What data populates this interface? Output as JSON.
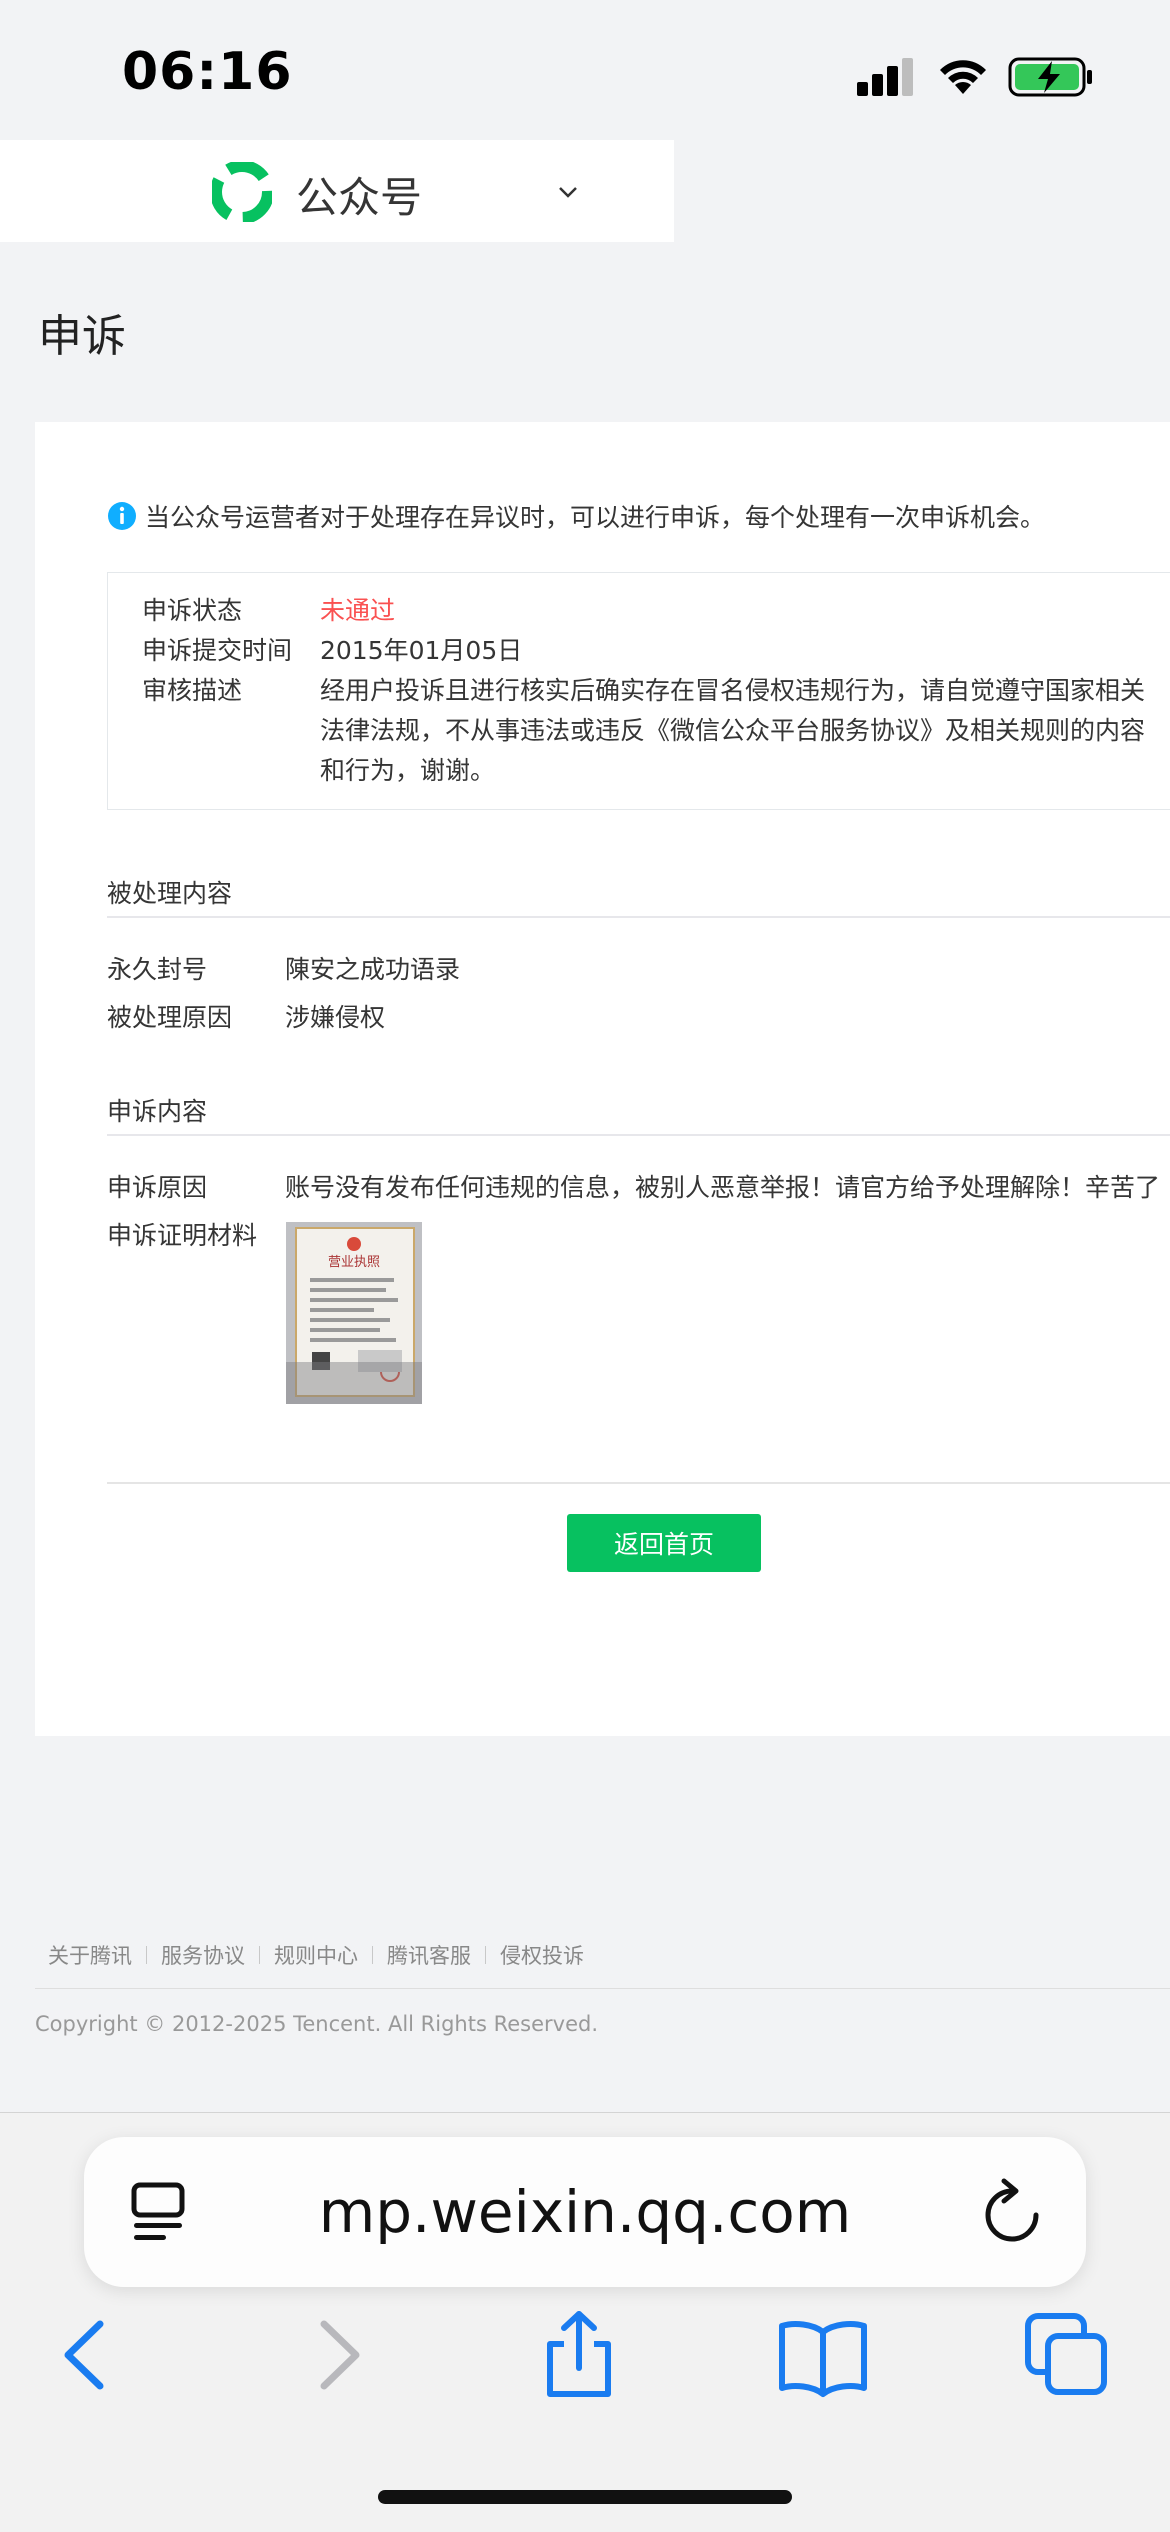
{
  "status_bar": {
    "time": "06:16"
  },
  "header": {
    "brand": "公众号"
  },
  "page": {
    "title": "申诉"
  },
  "notice": {
    "text": "当公众号运营者对于处理存在异议时，可以进行申诉，每个处理有一次申诉机会。"
  },
  "appeal_status": {
    "status_label": "申诉状态",
    "status_value": "未通过",
    "status_color": "#fa5151",
    "submit_label": "申诉提交时间",
    "submit_value": "2015年01月05日",
    "review_label": "审核描述",
    "review_lines": [
      "经用户投诉且进行核实后确实存在冒名侵权违规行为，请自觉遵守国家相关",
      "法律法规，不从事违法或违反《微信公众平台服务协议》及相关规则的内容",
      "和行为，谢谢。"
    ]
  },
  "processed": {
    "section_title": "被处理内容",
    "ban_label": "永久封号",
    "ban_value": "陳安之成功语录",
    "reason_label": "被处理原因",
    "reason_value": "涉嫌侵权"
  },
  "appeal_content": {
    "section_title": "申诉内容",
    "reason_label": "申诉原因",
    "reason_value": "账号没有发布任何违规的信息，被别人恶意举报！请官方给予处理解除！辛苦了",
    "evidence_label": "申诉证明材料",
    "evidence_image_title": "营业执照"
  },
  "actions": {
    "back_home": "返回首页",
    "button_color": "#07c160"
  },
  "footer": {
    "links": [
      "关于腾讯",
      "服务协议",
      "规则中心",
      "腾讯客服",
      "侵权投诉"
    ],
    "copyright": "Copyright © 2012-2025 Tencent. All Rights Reserved."
  },
  "browser": {
    "url": "mp.weixin.qq.com",
    "accent_color": "#1a7cf0",
    "toolbar_icons": [
      "back-icon",
      "forward-icon",
      "share-icon",
      "bookmarks-icon",
      "tabs-icon"
    ]
  }
}
